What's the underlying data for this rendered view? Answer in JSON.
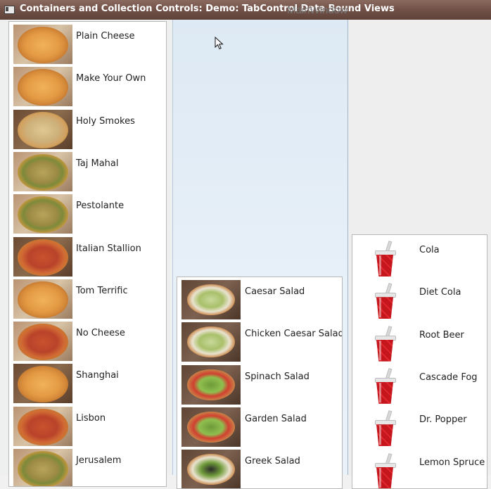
{
  "window": {
    "title": "Containers and Collection Controls: Demo: TabControl Data Bound Views",
    "ghost_title": "MainWindow"
  },
  "icons": {
    "app": "app-window-icon",
    "cursor": "mouse-pointer-icon",
    "pizza": "pizza-image",
    "salad": "salad-image",
    "drink": "soda-cup-icon"
  },
  "pizzas": [
    "Plain Cheese",
    "Make Your Own",
    "Holy Smokes",
    "Taj Mahal",
    "Pestolante",
    "Italian Stallion",
    "Tom Terrific",
    "No Cheese",
    "Shanghai",
    "Lisbon",
    "Jerusalem"
  ],
  "salads": [
    "Caesar Salad",
    "Chicken Caesar Salad",
    "Spinach Salad",
    "Garden Salad",
    "Greek Salad"
  ],
  "drinks": [
    "Cola",
    "Diet Cola",
    "Root Beer",
    "Cascade Fog",
    "Dr. Popper",
    "Lemon Spruce"
  ]
}
